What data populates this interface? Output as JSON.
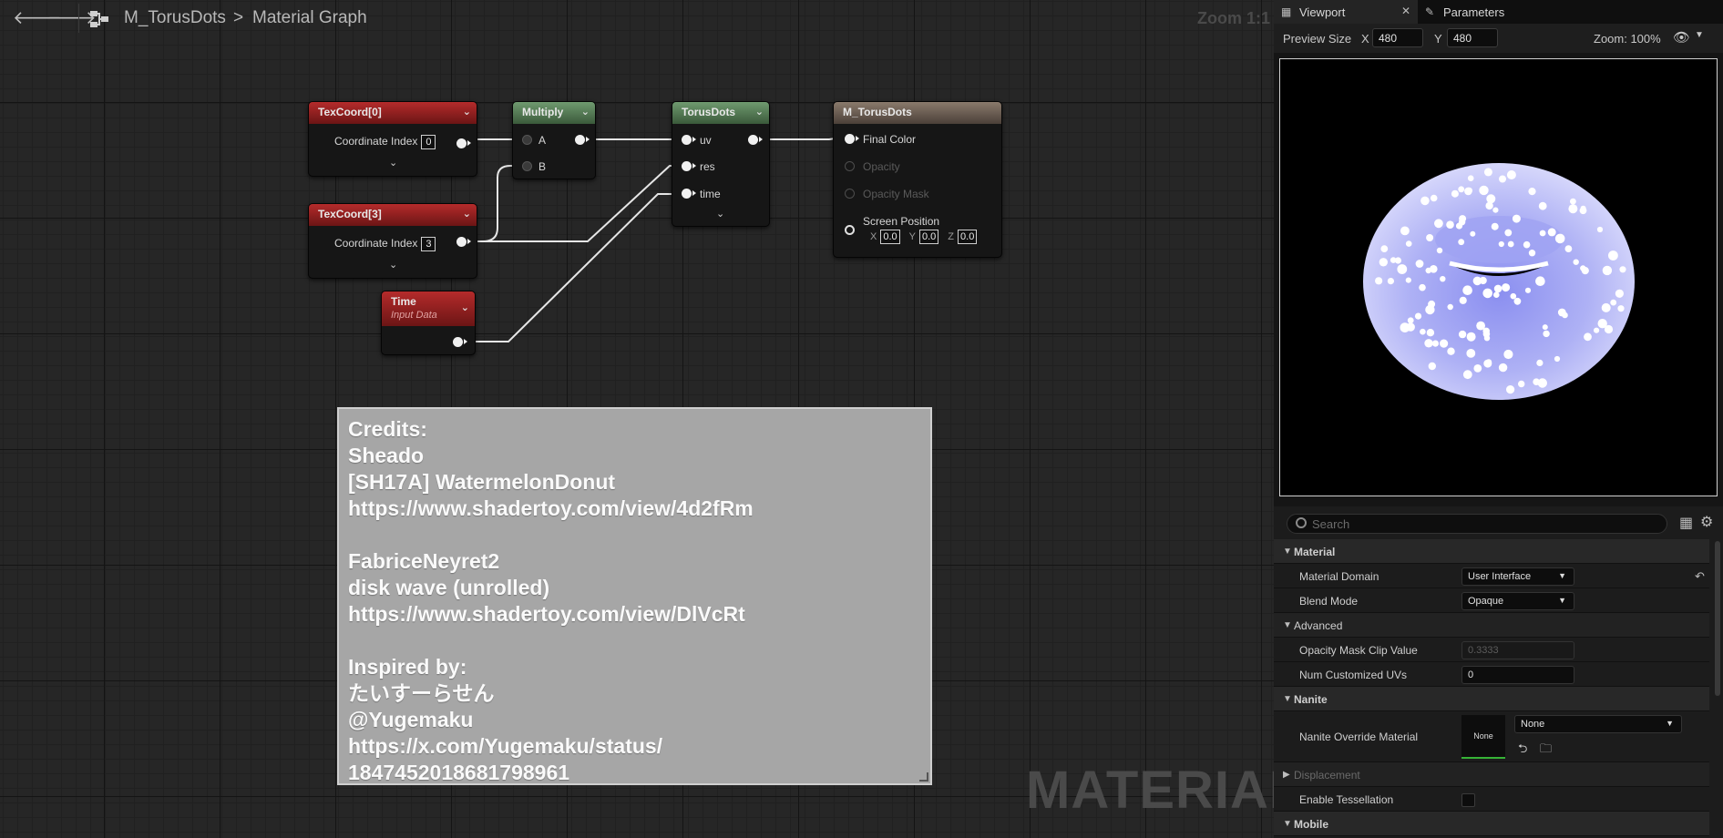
{
  "graph": {
    "breadcrumb": {
      "asset": "M_TorusDots",
      "separator": ">",
      "section": "Material Graph"
    },
    "zoom": "Zoom 1:1",
    "watermark": "MATERIAL",
    "nodes": {
      "texcoord0": {
        "title": "TexCoord[0]",
        "label": "Coordinate Index",
        "value": "0"
      },
      "texcoord3": {
        "title": "TexCoord[3]",
        "label": "Coordinate Index",
        "value": "3"
      },
      "time": {
        "title": "Time",
        "subtitle": "Input Data"
      },
      "multiply": {
        "title": "Multiply",
        "pin_a": "A",
        "pin_b": "B"
      },
      "torusdots": {
        "title": "TorusDots",
        "pin_uv": "uv",
        "pin_res": "res",
        "pin_time": "time"
      },
      "output": {
        "title": "M_TorusDots",
        "final_color": "Final Color",
        "opacity": "Opacity",
        "opacity_mask": "Opacity Mask",
        "screen_position": "Screen Position",
        "x_label": "X",
        "x_value": "0.0",
        "y_label": "Y",
        "y_value": "0.0",
        "z_label": "Z",
        "z_value": "0.0"
      }
    },
    "comment_lines": [
      "Credits:",
      "Sheado",
      "[SH17A] WatermelonDonut",
      "https://www.shadertoy.com/view/4d2fRm",
      "",
      "FabriceNeyret2",
      "disk wave (unrolled)",
      "https://www.shadertoy.com/view/DlVcRt",
      "",
      "Inspired by:",
      "たいすーらせん",
      "@Yugemaku",
      "https://x.com/Yugemaku/status/",
      "1847452018681798961"
    ]
  },
  "panel": {
    "tabs": [
      {
        "label": "Viewport",
        "icon": "grid-icon",
        "close": "✕"
      },
      {
        "label": "Parameters",
        "icon": "pencil-icon"
      }
    ],
    "preview": {
      "label": "Preview Size",
      "x_label": "X",
      "x_value": "480",
      "y_label": "Y",
      "y_value": "480",
      "zoom": "Zoom: 100%"
    },
    "search_placeholder": "Search",
    "details": {
      "material_category": "Material",
      "material_domain_label": "Material Domain",
      "material_domain_value": "User Interface",
      "blend_mode_label": "Blend Mode",
      "blend_mode_value": "Opaque",
      "advanced_category": "Advanced",
      "opacity_clip_label": "Opacity Mask Clip Value",
      "opacity_clip_value": "0.3333",
      "num_uvs_label": "Num Customized UVs",
      "num_uvs_value": "0",
      "nanite_category": "Nanite",
      "nanite_override_label": "Nanite Override Material",
      "nanite_thumb": "None",
      "nanite_override_value": "None",
      "displacement_category": "Displacement",
      "tessellation_label": "Enable Tessellation",
      "mobile_category": "Mobile"
    }
  },
  "colors": {
    "donut_base": "#b6b8f5",
    "donut_dots": "#ffffff",
    "node_red": "#9e2424",
    "node_green": "#5b805b",
    "comment_bg": "#a6a6a6"
  }
}
